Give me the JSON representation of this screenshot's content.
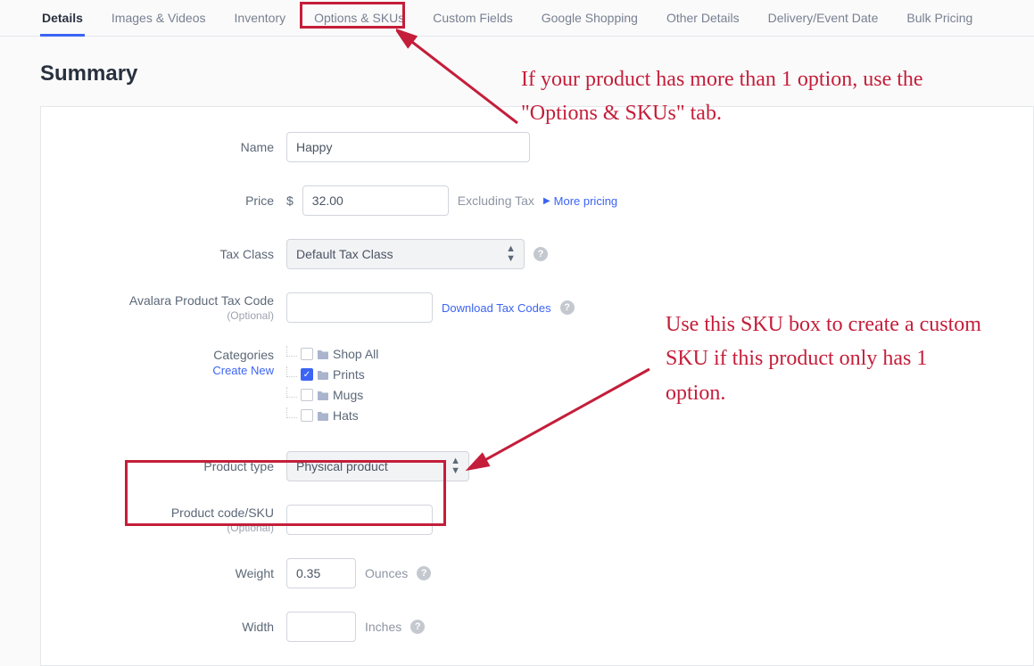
{
  "tabs": {
    "items": [
      {
        "label": "Details",
        "active": true
      },
      {
        "label": "Images & Videos"
      },
      {
        "label": "Inventory"
      },
      {
        "label": "Options & SKUs"
      },
      {
        "label": "Custom Fields"
      },
      {
        "label": "Google Shopping"
      },
      {
        "label": "Other Details"
      },
      {
        "label": "Delivery/Event Date"
      },
      {
        "label": "Bulk Pricing"
      }
    ]
  },
  "section": {
    "title": "Summary"
  },
  "form": {
    "name": {
      "label": "Name",
      "value": "Happy"
    },
    "price": {
      "label": "Price",
      "prefix": "$",
      "value": "32.00",
      "suffix": "Excluding Tax",
      "more": "More pricing"
    },
    "taxclass": {
      "label": "Tax Class",
      "value": "Default Tax Class"
    },
    "avalara": {
      "label": "Avalara Product Tax Code",
      "sublabel": "(Optional)",
      "link": "Download Tax Codes"
    },
    "categories": {
      "label": "Categories",
      "createlink": "Create New",
      "items": [
        {
          "label": "Shop All",
          "checked": false
        },
        {
          "label": "Prints",
          "checked": true
        },
        {
          "label": "Mugs",
          "checked": false
        },
        {
          "label": "Hats",
          "checked": false
        }
      ]
    },
    "producttype": {
      "label": "Product type",
      "value": "Physical product"
    },
    "sku": {
      "label": "Product code/SKU",
      "sublabel": "(Optional)"
    },
    "weight": {
      "label": "Weight",
      "value": "0.35",
      "unit": "Ounces"
    },
    "width": {
      "label": "Width",
      "unit": "Inches"
    }
  },
  "annotations": {
    "top": "If your product has more than 1 option, use the \"Options & SKUs\" tab.",
    "bottom": "Use this SKU box to create a custom SKU if this product only has 1 option."
  }
}
